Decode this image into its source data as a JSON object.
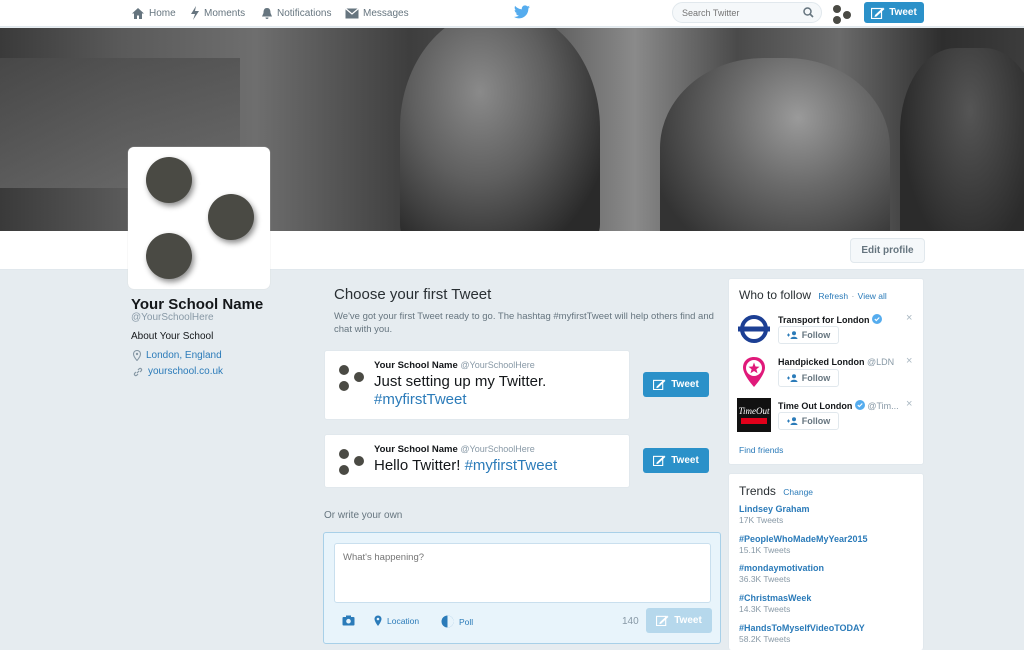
{
  "nav": {
    "home": "Home",
    "moments": "Moments",
    "notifications": "Notifications",
    "messages": "Messages",
    "search_placeholder": "Search Twitter",
    "tweet_label": "Tweet"
  },
  "profile": {
    "name": "Your School Name",
    "handle": "@YourSchoolHere",
    "about": "About Your School",
    "location": "London, England",
    "website": "yourschool.co.uk",
    "edit_label": "Edit profile"
  },
  "first_tweet": {
    "title": "Choose your first Tweet",
    "description": "We've got your first Tweet ready to go. The hashtag #myfirstTweet will help others find and chat with you.",
    "cards": [
      {
        "author": "Your School Name",
        "handle": "@YourSchoolHere",
        "text": "Just setting up my Twitter.",
        "hashtag": "#myfirstTweet",
        "button": "Tweet"
      },
      {
        "author": "Your School Name",
        "handle": "@YourSchoolHere",
        "text": "Hello Twitter!",
        "hashtag": "#myfirstTweet",
        "button": "Tweet"
      }
    ],
    "write_own": "Or write your own"
  },
  "composer": {
    "placeholder": "What's happening?",
    "location": "Location",
    "poll": "Poll",
    "count": "140",
    "button": "Tweet"
  },
  "who_to_follow": {
    "title": "Who to follow",
    "refresh": "Refresh",
    "view_all": "View all",
    "items": [
      {
        "name": "Transport for London",
        "handle": "",
        "verified": true,
        "follow": "Follow",
        "icon": "tfl-roundel-icon"
      },
      {
        "name": "Handpicked London",
        "handle": "@LDN",
        "verified": false,
        "follow": "Follow",
        "icon": "star-pin-icon"
      },
      {
        "name": "Time Out London",
        "handle": "@Tim...",
        "verified": true,
        "follow": "Follow",
        "icon": "timeout-logo-icon"
      }
    ],
    "find_friends": "Find friends",
    "dismiss": "×"
  },
  "trends": {
    "title": "Trends",
    "change": "Change",
    "items": [
      {
        "name": "Lindsey Graham",
        "count": "17K Tweets"
      },
      {
        "name": "#PeopleWhoMadeMyYear2015",
        "count": "15.1K Tweets"
      },
      {
        "name": "#mondaymotivation",
        "count": "36.3K Tweets"
      },
      {
        "name": "#ChristmasWeek",
        "count": "14.3K Tweets"
      },
      {
        "name": "#HandsToMyselfVideoTODAY",
        "count": "58.2K Tweets"
      }
    ]
  },
  "colors": {
    "accent": "#2b91c9",
    "link": "#2b7bb9",
    "background": "#e6ecf0"
  }
}
